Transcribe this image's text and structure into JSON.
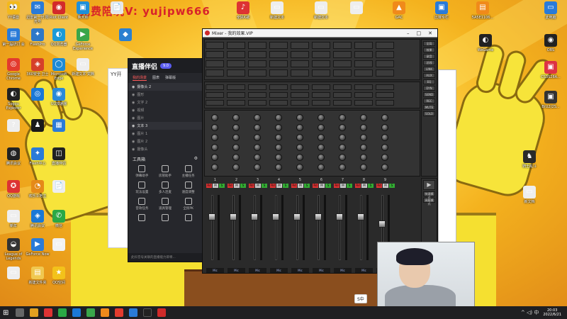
{
  "watermark": "免费陪玩V: yujipw666",
  "desktop_icons": [
    {
      "label": "YY语音",
      "color": "#f3b91c",
      "glyph": "👀"
    },
    {
      "label": "迅雷第一代\n阳光号",
      "color": "#2a7bd8",
      "glyph": "✉"
    },
    {
      "label": "Riot Client",
      "color": "#d32a2a",
      "glyph": "◉"
    },
    {
      "label": "鲁大师",
      "color": "#1f8fd8",
      "glyph": "▣"
    },
    {
      "label": "",
      "color": "#e8e8e8",
      "glyph": "📄"
    },
    {
      "label": "第一届研讨\n会",
      "color": "#2a7bd8",
      "glyph": "▤"
    },
    {
      "label": "FlashPro",
      "color": "#2e78c8",
      "glyph": "✦"
    },
    {
      "label": "QQ浏览器",
      "color": "#1a9ad8",
      "glyph": "◐"
    },
    {
      "label": "GeForce\nExperience",
      "color": "#3aa64a",
      "glyph": "▶"
    },
    {
      "label": "",
      "color": "#2b80d0",
      "glyph": "◆"
    },
    {
      "label": "Google\nChrome",
      "color": "#e33b2e",
      "glyph": "◎"
    },
    {
      "label": "360安全\n卫士",
      "color": "#d6402a",
      "glyph": "◈"
    },
    {
      "label": "Microsoft\nEdge",
      "color": "#1d8ad6",
      "glyph": "◯"
    },
    {
      "label": "新建文本\n文档",
      "color": "#eeeeee",
      "glyph": "▭"
    },
    {
      "label": "Sogou\nExplorer",
      "color": "#222",
      "glyph": "◐"
    },
    {
      "label": "",
      "color": "#1a78d6",
      "glyph": "◎"
    },
    {
      "label": "UU加速器",
      "color": "#2a8ad8",
      "glyph": "◉"
    },
    {
      "label": "",
      "color": "#eee",
      "glyph": "?"
    },
    {
      "label": "",
      "color": "#1a1a1a",
      "glyph": "♟"
    },
    {
      "label": "",
      "color": "#2a7bd8",
      "glyph": "▦"
    },
    {
      "label": "腾讯会议",
      "color": "#222",
      "glyph": "◍"
    },
    {
      "label": "Flash中心",
      "color": "#2a7bd8",
      "glyph": "✦"
    },
    {
      "label": "直播伴侣",
      "color": "#222",
      "glyph": "◫"
    },
    {
      "label": "QQ游戏",
      "color": "#d33",
      "glyph": "✪"
    },
    {
      "label": "欢乐斗地主",
      "color": "#e58a18",
      "glyph": "◔"
    },
    {
      "label": "",
      "color": "#eee",
      "glyph": "📄"
    },
    {
      "label": "新年",
      "color": "#eee",
      "glyph": "▭"
    },
    {
      "label": "腾讯会议",
      "color": "#1a78d6",
      "glyph": "◈"
    },
    {
      "label": "微信",
      "color": "#2aa845",
      "glyph": "✆"
    },
    {
      "label": "League of\nLegends",
      "color": "#333",
      "glyph": "◒"
    },
    {
      "label": "GeForce\nNow",
      "color": "#2a7bd8",
      "glyph": "▶"
    },
    {
      "label": "",
      "color": "#f2f2f2",
      "glyph": "▭"
    },
    {
      "label": "",
      "color": "#eee",
      "glyph": "▭"
    },
    {
      "label": "新建文件夹",
      "color": "#f0c850",
      "glyph": "▤"
    },
    {
      "label": "QQ空间",
      "color": "#f3c21a",
      "glyph": "★"
    },
    {
      "label": "全民K歌",
      "color": "#d33",
      "glyph": "♪"
    },
    {
      "label": "新建文本",
      "color": "#eee",
      "glyph": "▭"
    },
    {
      "label": "新建文本",
      "color": "#eee",
      "glyph": "▭"
    },
    {
      "label": "",
      "color": "#eee",
      "glyph": "▭"
    },
    {
      "label": "GAC",
      "color": "#f08a1a",
      "glyph": "▲"
    },
    {
      "label": "比赛专栏",
      "color": "#2a7bd8",
      "glyph": "▣"
    },
    {
      "label": "5A5E1106...",
      "color": "#f08a1a",
      "glyph": "▤"
    },
    {
      "label": "此电脑",
      "color": "#2a7bd8",
      "glyph": "▭"
    },
    {
      "label": "WeGame",
      "color": "#222",
      "glyph": "◐"
    },
    {
      "label": "OBS",
      "color": "#222",
      "glyph": "◉"
    },
    {
      "label": "CS3S28A...",
      "color": "#d34",
      "glyph": "▣"
    },
    {
      "label": "B(U2)2S...",
      "color": "#333",
      "glyph": "▣"
    },
    {
      "label": "骑士乱斗",
      "color": "#2a2a2a",
      "glyph": "♞"
    },
    {
      "label": "新文档",
      "color": "#eee",
      "glyph": "▭"
    }
  ],
  "companion": {
    "logo": "直播伴侣",
    "badge": "9.0",
    "tabs": [
      "我的场景",
      "图表",
      "弹幕版"
    ],
    "active_tab": "我的场景",
    "scenes": [
      "摄像头 2",
      "图形",
      "文字 2",
      "视频",
      "图片",
      "文本 3",
      "图片 1",
      "图片 2",
      "摄像头"
    ],
    "tools_title": "工具箱",
    "tools": [
      "弹幕助手",
      "房管助手",
      "主播任务",
      "玩法设置",
      "多人连麦",
      "速度调整",
      "音效任务",
      "道具管理",
      "全民PK",
      "",
      "",
      ""
    ],
    "footer": "此抖音号关联的直播能力即将..."
  },
  "mixer": {
    "title": "Mixer - 我的效果.VIP",
    "win_buttons": [
      "–",
      "□",
      "✕"
    ],
    "strip_numbers": [
      "1",
      "2",
      "3",
      "4",
      "5",
      "6",
      "7",
      "8",
      "9"
    ],
    "strip_labels": [
      "Mic",
      "Mic",
      "Mic",
      "Mic",
      "Mic",
      "Mic",
      "Mic",
      "Mic",
      "Master"
    ],
    "right_buttons": [
      "全局",
      "效果",
      "录音",
      "总线",
      "LINK",
      "AUX",
      "EQ",
      "DYN",
      "SEND",
      "REC",
      "MUTE",
      "SOLO"
    ],
    "bottom_buttons": [
      "快速模式",
      "高级模式"
    ]
  },
  "ime": "S中",
  "taskbar": {
    "time": "20:03",
    "date": "2022/6/21",
    "tray": "^ ◁) 中"
  }
}
